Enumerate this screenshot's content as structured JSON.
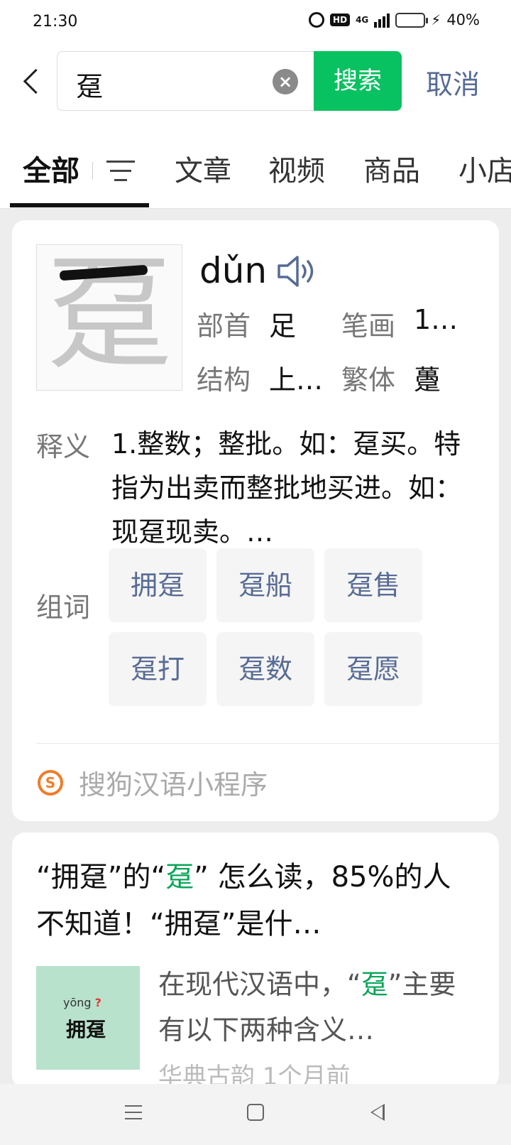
{
  "status": {
    "time": "21:30",
    "network": "HD",
    "network_gen": "4G",
    "battery": "40%",
    "battery_level": 0.4
  },
  "search": {
    "query": "趸",
    "button": "搜索",
    "cancel": "取消"
  },
  "tabs": [
    {
      "label": "全部",
      "active": true
    },
    {
      "label": "文章"
    },
    {
      "label": "视频"
    },
    {
      "label": "商品"
    },
    {
      "label": "小店"
    }
  ],
  "dict": {
    "char": "趸",
    "pinyin": "dǔn",
    "radical_label": "部首",
    "radical": "足",
    "strokes_label": "笔画",
    "strokes": "1…",
    "structure_label": "结构",
    "structure": "上…",
    "traditional_label": "繁体",
    "traditional": "躉",
    "definition_label": "释义",
    "definition": "1.整数；整批。如：趸买。特指为出卖而整批地买进。如：现趸现卖。…",
    "words_label": "组词",
    "words": [
      "拥趸",
      "趸船",
      "趸售",
      "趸打",
      "趸数",
      "趸愿"
    ],
    "source": "搜狗汉语小程序"
  },
  "article": {
    "title_pre": "“拥趸”的“",
    "title_hl": "趸",
    "title_post": "” 怎么读，85%的人不知道！“拥趸”是什…",
    "thumb_pinyin": "yōng",
    "thumb_mark": "?",
    "thumb_word": "拥趸",
    "snippet_pre": "在现代汉语中，“",
    "snippet_hl": "趸",
    "snippet_post": "”主要有以下两种含义…",
    "meta": "华典古韵 1个月前"
  },
  "colors": {
    "accent": "#08c160",
    "link": "#576b95",
    "highlight": "#08a656"
  }
}
